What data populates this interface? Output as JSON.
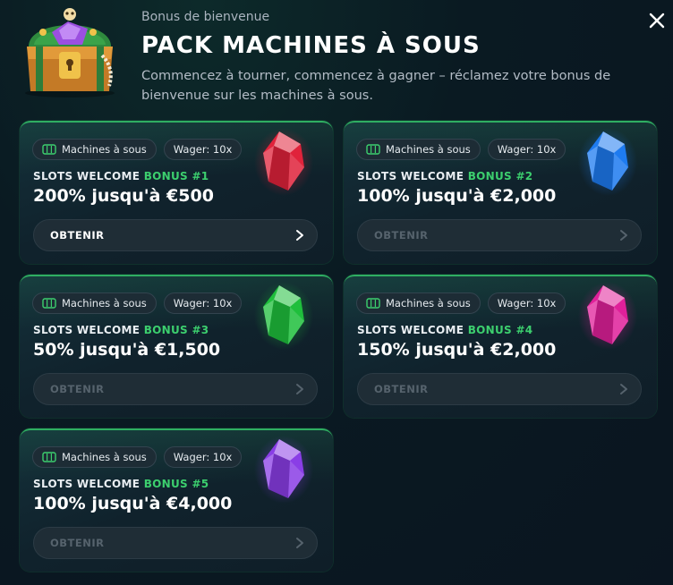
{
  "header": {
    "subtitle": "Bonus de bienvenue",
    "title": "PACK MACHINES À SOUS",
    "description": "Commencez à tourner, commencez à gagner – réclamez votre bonus de bienvenue sur les machines à sous.",
    "close_icon": "close-icon",
    "chest_icon": "treasure-chest-icon"
  },
  "cards": [
    {
      "chip_category": "Machines à sous",
      "chip_wager": "Wager: 10x",
      "title_prefix": "SLOTS WELCOME ",
      "title_highlight": "BONUS #1",
      "amount": "200% jusqu'à €500",
      "button": "OBTENIR",
      "button_state": "active",
      "gem_color": "#e0233b",
      "gem_icon": "red-gem-icon"
    },
    {
      "chip_category": "Machines à sous",
      "chip_wager": "Wager: 10x",
      "title_prefix": "SLOTS WELCOME ",
      "title_highlight": "BONUS #2",
      "amount": "100% jusqu'à €2,000",
      "button": "OBTENIR",
      "button_state": "disabled",
      "gem_color": "#1e7bf0",
      "gem_icon": "blue-gem-icon"
    },
    {
      "chip_category": "Machines à sous",
      "chip_wager": "Wager: 10x",
      "title_prefix": "SLOTS WELCOME ",
      "title_highlight": "BONUS #3",
      "amount": "50% jusqu'à €1,500",
      "button": "OBTENIR",
      "button_state": "disabled",
      "gem_color": "#1fbf3c",
      "gem_icon": "green-gem-icon"
    },
    {
      "chip_category": "Machines à sous",
      "chip_wager": "Wager: 10x",
      "title_prefix": "SLOTS WELCOME ",
      "title_highlight": "BONUS #4",
      "amount": "150% jusqu'à €2,000",
      "button": "OBTENIR",
      "button_state": "disabled",
      "gem_color": "#e0209a",
      "gem_icon": "pink-gem-icon"
    },
    {
      "chip_category": "Machines à sous",
      "chip_wager": "Wager: 10x",
      "title_prefix": "SLOTS WELCOME ",
      "title_highlight": "BONUS #5",
      "amount": "100% jusqu'à €4,000",
      "button": "OBTENIR",
      "button_state": "disabled",
      "gem_color": "#8a3ee6",
      "gem_icon": "purple-gem-icon"
    }
  ],
  "colors": {
    "accent_green": "#3ccf6e",
    "card_border": "#2fae62"
  }
}
